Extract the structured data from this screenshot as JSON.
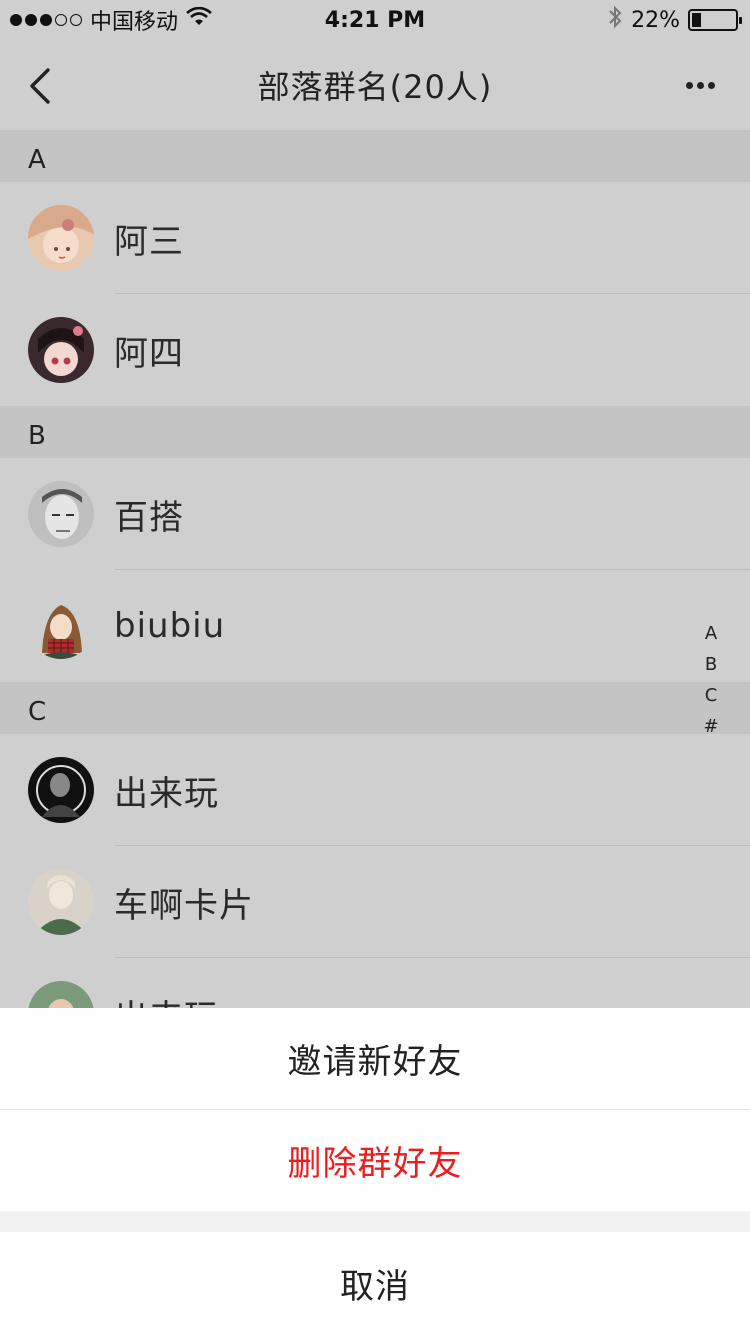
{
  "status_bar": {
    "carrier": "中国移动",
    "time": "4:21 PM",
    "battery_percent": "22%",
    "battery_level": 0.22,
    "icons": [
      "signal-dots",
      "wifi-icon",
      "bluetooth-icon",
      "battery-icon"
    ]
  },
  "nav": {
    "title": "部落群名(20人)",
    "back_icon": "chevron-left-icon",
    "more_icon": "ellipsis-icon"
  },
  "sections": [
    {
      "letter": "A",
      "members": [
        {
          "name": "阿三"
        },
        {
          "name": "阿四"
        }
      ]
    },
    {
      "letter": "B",
      "members": [
        {
          "name": "百搭"
        },
        {
          "name": "biubiu"
        }
      ]
    },
    {
      "letter": "C",
      "members": [
        {
          "name": "出来玩"
        },
        {
          "name": "车啊卡片"
        },
        {
          "name": "出来玩"
        }
      ]
    }
  ],
  "index_letters": [
    "A",
    "B",
    "C",
    "#"
  ],
  "action_sheet": {
    "invite_label": "邀请新好友",
    "delete_label": "删除群好友",
    "cancel_label": "取消"
  },
  "colors": {
    "delete_red": "#ee1c1c",
    "overlay_bg": "#cfcfcf",
    "section_bg": "#c4c4c4"
  }
}
